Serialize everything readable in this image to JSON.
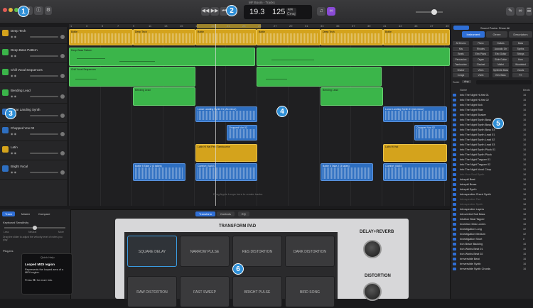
{
  "window_title": "MF Boom - Tracks",
  "lcd": {
    "bar": "19.3",
    "tempo": "125",
    "signature_top": "4/4",
    "key": "Cmaj",
    "tempo_label": "TEMPO",
    "bar_label": "BAR"
  },
  "callouts": [
    "1",
    "2",
    "3",
    "4",
    "5",
    "6"
  ],
  "tracks": [
    {
      "name": "Deep Tech",
      "color": "#d4a31c"
    },
    {
      "name": "Deep Bass Pattern",
      "color": "#3bb54a"
    },
    {
      "name": "Chill Vocal Sequences",
      "color": "#3bb54a"
    },
    {
      "name": "Bending Lead",
      "color": "#3bb54a"
    },
    {
      "name": "Lunar Landing Synth",
      "color": "#2e6fc1"
    },
    {
      "name": "Chopped Vox 02",
      "color": "#2e6fc1"
    },
    {
      "name": "Latin",
      "color": "#d4a31c"
    },
    {
      "name": "Bright Vocal",
      "color": "#2e6fc1"
    }
  ],
  "ruler": [
    "1",
    "3",
    "5",
    "7",
    "9",
    "11",
    "13",
    "15",
    "17",
    "19",
    "21",
    "23",
    "25",
    "27",
    "29",
    "31",
    "33",
    "35",
    "37",
    "39",
    "41",
    "43",
    "45",
    "47",
    "49"
  ],
  "regions": [
    {
      "label": "Bottle"
    },
    {
      "label": "Deep Tech"
    },
    {
      "label": "Bottle"
    },
    {
      "label": "Bottle"
    },
    {
      "label": "Deep Tech"
    },
    {
      "label": "Bottle"
    },
    {
      "label": "Deep Bass Pattern"
    },
    {
      "label": "Chill Vocal Sequences"
    },
    {
      "label": "Bending Lead"
    },
    {
      "label": "Bending Lead"
    },
    {
      "label": "Lunar Landing Synth 01 (Ab minor)"
    },
    {
      "label": "Lunar Landing Synth 01 (Ab minor)"
    },
    {
      "label": "Chopped Vox 02"
    },
    {
      "label": "Chopped Vox 02"
    },
    {
      "label": "Latin Hi Hat Perc Tambourine"
    },
    {
      "label": "Latin Hi Hat"
    },
    {
      "label": "Bottle 5 Take 2 (3 takes)"
    },
    {
      "label": "Comfort_BASS"
    },
    {
      "label": "Bottle 5 Take 2 (3 takes)"
    },
    {
      "label": "Comfort_BASS"
    }
  ],
  "drop_hint": "Drag Apple Loops here to create tracks",
  "inspector": {
    "tabs": [
      "Track",
      "Master",
      "Compare"
    ],
    "keyboard_sensitivity": "Keyboard Sensitivity",
    "less": "Less",
    "neutral": "Neutral",
    "more": "More",
    "help_text": "Drag the slider to adjust the velocity level of notes you play.",
    "plug_ins": "Plug-ins"
  },
  "quick_help": {
    "title": "Quick Help",
    "heading": "Looped MIDI region",
    "body": "Represents the looped area of a MIDI region.",
    "hint": "Press ⌘/ for more info."
  },
  "editor_tabs": [
    "Transform",
    "Controls",
    "EQ"
  ],
  "transform_pad": {
    "title": "TRANSFORM PAD",
    "cells": [
      "SQUARE DELAY",
      "NARROW PULSE",
      "RES DISTORTION",
      "DARK DISTORTION",
      "RAW DISTORTION",
      "FAST SWEEP",
      "BRIGHT PULSE",
      "BIRD SONG"
    ],
    "knob1": "DELAY+REVERB",
    "knob2": "DISTORTION"
  },
  "library": {
    "sound_packs": "Sound Packs: Show All",
    "tabs": [
      "Instrument",
      "Genre",
      "Descriptors"
    ],
    "keywords": [
      "All Drums",
      "Piano",
      "Guitars",
      "Bass",
      "Kits",
      "Rhodes",
      "Acoustic Gtr",
      "Synths",
      "Beats",
      "Elec Piano",
      "Elec Guitar",
      "Strings",
      "Percussion",
      "Organ",
      "Slide Guitar",
      "Horn",
      "Tambourine",
      "Clavinet",
      "Mallet",
      "Woodwind",
      "Shaker",
      "Vibes",
      "Synthetic Bass",
      "Vocals",
      "Conga",
      "Violin",
      "Elec Bass",
      "FX"
    ],
    "scale_label": "Scale",
    "scale_value": "Any",
    "col_name": "Name",
    "col_beats": "Beats",
    "loops": [
      {
        "name": "Into The Night Hi-Hat 01",
        "beats": "16"
      },
      {
        "name": "Into The Night Hi-Hat 02",
        "beats": "16"
      },
      {
        "name": "Into The Night Kick",
        "beats": "16"
      },
      {
        "name": "Into The Night Ride",
        "beats": "16"
      },
      {
        "name": "Into The Night Shaker",
        "beats": "16"
      },
      {
        "name": "Into The Night Synth Bass",
        "beats": "16"
      },
      {
        "name": "Into The Night Synth Bass 02",
        "beats": "16"
      },
      {
        "name": "Into The Night Synth Bass 03",
        "beats": "16"
      },
      {
        "name": "Into The Night Synth Lead 01",
        "beats": "16"
      },
      {
        "name": "Into The Night Synth Lead 02",
        "beats": "16"
      },
      {
        "name": "Into The Night Synth Lead 03",
        "beats": "16"
      },
      {
        "name": "Into The Night Synth Pluck 01",
        "beats": "16"
      },
      {
        "name": "Into The Night Synth Pluck",
        "beats": "16"
      },
      {
        "name": "Into The Night Trapper 01",
        "beats": "16"
      },
      {
        "name": "Into The Night Trapper 02",
        "beats": "16"
      },
      {
        "name": "Into The Night Vocal Chop",
        "beats": "16"
      },
      {
        "name": "Into Your Soul Synth",
        "beats": "16"
      },
      {
        "name": "Intrepid Beat",
        "beats": "16"
      },
      {
        "name": "Intrepid Brass",
        "beats": "16"
      },
      {
        "name": "Intrepid Synth",
        "beats": "16"
      },
      {
        "name": "Introspective Chord Synth",
        "beats": "16"
      },
      {
        "name": "Introspective Pad",
        "beats": "16"
      },
      {
        "name": "Introspective Synth",
        "beats": "16"
      },
      {
        "name": "Introspective Layers",
        "beats": "16"
      },
      {
        "name": "Introverted Sub Bass",
        "beats": "16"
      },
      {
        "name": "Intuition Beat Tapper",
        "beats": "16"
      },
      {
        "name": "Invention Disk Lovers",
        "beats": "16"
      },
      {
        "name": "Investigation Long",
        "beats": "32"
      },
      {
        "name": "Investigation Medium",
        "beats": "32"
      },
      {
        "name": "Investigation Short",
        "beats": "8"
      },
      {
        "name": "Iron Brace Backing",
        "beats": "16"
      },
      {
        "name": "Iron Works Beat 01",
        "beats": "16"
      },
      {
        "name": "Iron Works Beat 02",
        "beats": "16"
      },
      {
        "name": "Irreversible Beat",
        "beats": "16"
      },
      {
        "name": "Irreversible Synth",
        "beats": "16"
      },
      {
        "name": "Irreversible Synth Chords",
        "beats": "16"
      }
    ]
  }
}
